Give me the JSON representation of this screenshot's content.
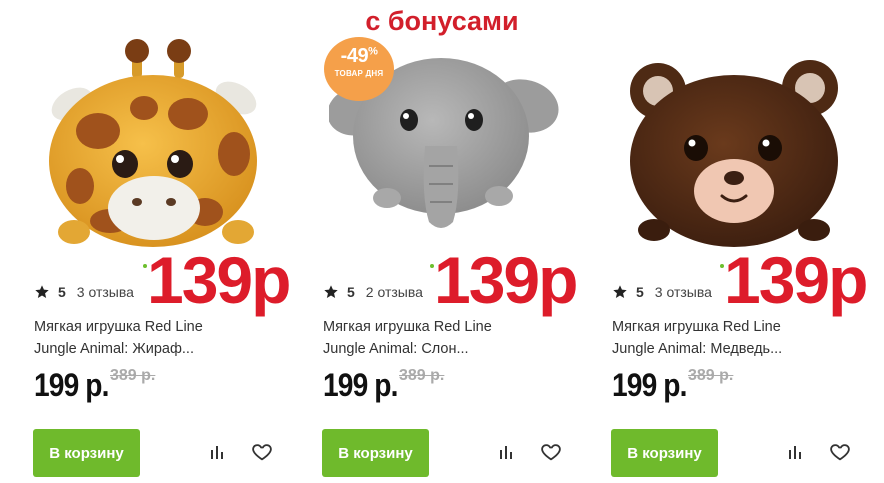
{
  "promo_banner": "с бонусами",
  "products": [
    {
      "animal": "giraffe",
      "image_icon": "giraffe-plush-image",
      "rating": "5",
      "reviews": "3 отзыва",
      "bonus_price": "139р",
      "name_line1": "Мягкая игрушка Red Line",
      "name_line2": "Jungle Animal: Жираф...",
      "price": "199 р.",
      "old_price": "389 р.",
      "cart_label": "В корзину"
    },
    {
      "animal": "elephant",
      "image_icon": "elephant-plush-image",
      "badge_percent": "-49",
      "badge_percent_sign": "%",
      "badge_label": "ТОВАР ДНЯ",
      "rating": "5",
      "reviews": "2 отзыва",
      "bonus_price": "139р",
      "name_line1": "Мягкая игрушка Red Line",
      "name_line2": "Jungle Animal: Слон...",
      "price": "199 р.",
      "old_price": "389 р.",
      "cart_label": "В корзину"
    },
    {
      "animal": "bear",
      "image_icon": "bear-plush-image",
      "rating": "5",
      "reviews": "3 отзыва",
      "bonus_price": "139р",
      "name_line1": "Мягкая игрушка Red Line",
      "name_line2": "Jungle Animal: Медведь...",
      "price": "199 р.",
      "old_price": "389 р.",
      "cart_label": "В корзину"
    }
  ],
  "colors": {
    "accent_green": "#6fba2c",
    "bonus_red": "#dd1c2a",
    "badge_orange": "#f5a04a"
  },
  "icons": [
    "star-icon",
    "compare-icon",
    "heart-icon"
  ]
}
